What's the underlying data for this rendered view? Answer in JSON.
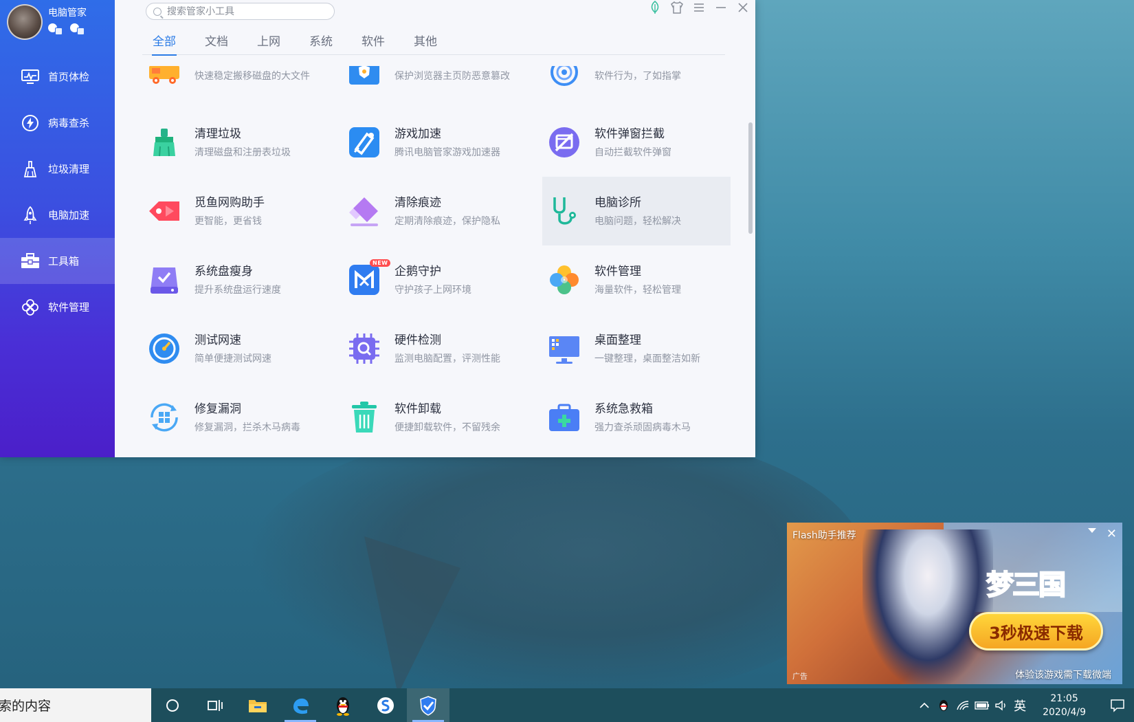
{
  "app": {
    "brand_name": "电脑管家",
    "search_placeholder": "搜索管家小工具"
  },
  "sidebar": {
    "items": [
      {
        "label": "首页体检",
        "icon": "monitor-icon",
        "active": false
      },
      {
        "label": "病毒查杀",
        "icon": "lightning-shield-icon",
        "active": false
      },
      {
        "label": "垃圾清理",
        "icon": "broom-icon",
        "active": false
      },
      {
        "label": "电脑加速",
        "icon": "rocket-icon",
        "active": false
      },
      {
        "label": "工具箱",
        "icon": "toolbox-icon",
        "active": true
      },
      {
        "label": "软件管理",
        "icon": "clover-icon",
        "active": false
      }
    ]
  },
  "tabs": [
    {
      "label": "全部",
      "active": true
    },
    {
      "label": "文档",
      "active": false
    },
    {
      "label": "上网",
      "active": false
    },
    {
      "label": "系统",
      "active": false
    },
    {
      "label": "软件",
      "active": false
    },
    {
      "label": "其他",
      "active": false
    }
  ],
  "tools": [
    {
      "name": "",
      "desc": "快速稳定搬移磁盘的大文件",
      "icon": "truck-icon"
    },
    {
      "name": "",
      "desc": "保护浏览器主页防恶意篡改",
      "icon": "browser-shield-icon"
    },
    {
      "name": "",
      "desc": "软件行为，了如指掌",
      "icon": "radar-icon"
    },
    {
      "name": "清理垃圾",
      "desc": "清理磁盘和注册表垃圾",
      "icon": "broom-icon"
    },
    {
      "name": "游戏加速",
      "desc": "腾讯电脑管家游戏加速器",
      "icon": "game-boost-icon"
    },
    {
      "name": "软件弹窗拦截",
      "desc": "自动拦截软件弹窗",
      "icon": "popup-block-icon"
    },
    {
      "name": "觅鱼网购助手",
      "desc": "更智能，更省钱",
      "icon": "price-tag-icon"
    },
    {
      "name": "清除痕迹",
      "desc": "定期清除痕迹，保护隐私",
      "icon": "eraser-icon"
    },
    {
      "name": "电脑诊所",
      "desc": "电脑问题，轻松解决",
      "icon": "stethoscope-icon"
    },
    {
      "name": "系统盘瘦身",
      "desc": "提升系统盘运行速度",
      "icon": "disk-check-icon"
    },
    {
      "name": "企鹅守护",
      "desc": "守护孩子上网环境",
      "icon": "penguin-guard-icon",
      "badge": "NEW"
    },
    {
      "name": "软件管理",
      "desc": "海量软件，轻松管理",
      "icon": "clover-icon"
    },
    {
      "name": "测试网速",
      "desc": "简单便捷测试网速",
      "icon": "speedometer-icon"
    },
    {
      "name": "硬件检测",
      "desc": "监测电脑配置，评测性能",
      "icon": "chip-icon"
    },
    {
      "name": "桌面整理",
      "desc": "一键整理，桌面整洁如新",
      "icon": "desktop-icon"
    },
    {
      "name": "修复漏洞",
      "desc": "修复漏洞，拦杀木马病毒",
      "icon": "windows-repair-icon"
    },
    {
      "name": "软件卸载",
      "desc": "便捷卸载软件，不留残余",
      "icon": "trash-icon"
    },
    {
      "name": "系统急救箱",
      "desc": "强力查杀顽固病毒木马",
      "icon": "first-aid-icon"
    }
  ],
  "ad": {
    "source": "Flash助手推荐",
    "logo": "梦三国",
    "cta": "3秒极速下载",
    "tag": "广告",
    "note": "体验该游戏需下载微端"
  },
  "taskbar": {
    "search_text": "索的内容",
    "language": "英",
    "time": "21:05",
    "date": "2020/4/9"
  },
  "colors": {
    "accent": "#2a7be6",
    "sidebar_top": "#2f6de8",
    "sidebar_bottom": "#4b1fc9"
  }
}
